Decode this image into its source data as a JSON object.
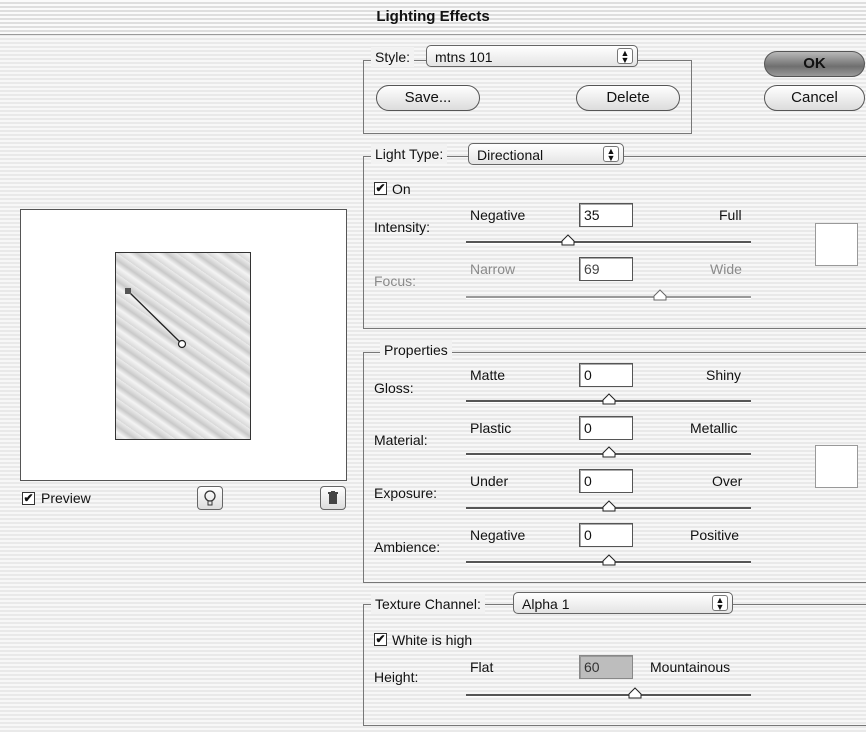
{
  "window": {
    "title": "Lighting Effects"
  },
  "style_box": {
    "label": "Style:",
    "value": "mtns 101",
    "save_label": "Save...",
    "delete_label": "Delete"
  },
  "dialog_buttons": {
    "ok_label": "OK",
    "cancel_label": "Cancel"
  },
  "preview": {
    "checkbox_label": "Preview",
    "checked": true
  },
  "light": {
    "type_label": "Light Type:",
    "type_value": "Directional",
    "on_label": "On",
    "on_checked": true,
    "intensity": {
      "label": "Intensity:",
      "min_label": "Negative",
      "max_label": "Full",
      "value": "35",
      "level": 0.35
    },
    "focus": {
      "label": "Focus:",
      "min_label": "Narrow",
      "max_label": "Wide",
      "value": "69",
      "level": 0.69
    }
  },
  "properties": {
    "title": "Properties",
    "gloss": {
      "label": "Gloss:",
      "min_label": "Matte",
      "max_label": "Shiny",
      "value": "0",
      "level": 0.5
    },
    "material": {
      "label": "Material:",
      "min_label": "Plastic",
      "max_label": "Metallic",
      "value": "0",
      "level": 0.5
    },
    "exposure": {
      "label": "Exposure:",
      "min_label": "Under",
      "max_label": "Over",
      "value": "0",
      "level": 0.5
    },
    "ambience": {
      "label": "Ambience:",
      "min_label": "Negative",
      "max_label": "Positive",
      "value": "0",
      "level": 0.5
    }
  },
  "texture": {
    "channel_label": "Texture Channel:",
    "channel_value": "Alpha 1",
    "white_high_label": "White is high",
    "white_high_checked": true,
    "height": {
      "label": "Height:",
      "min_label": "Flat",
      "max_label": "Mountainous",
      "value": "60",
      "level": 0.6
    }
  },
  "icons": {
    "new_light": "lightbulb-icon",
    "delete_light": "trash-icon"
  }
}
